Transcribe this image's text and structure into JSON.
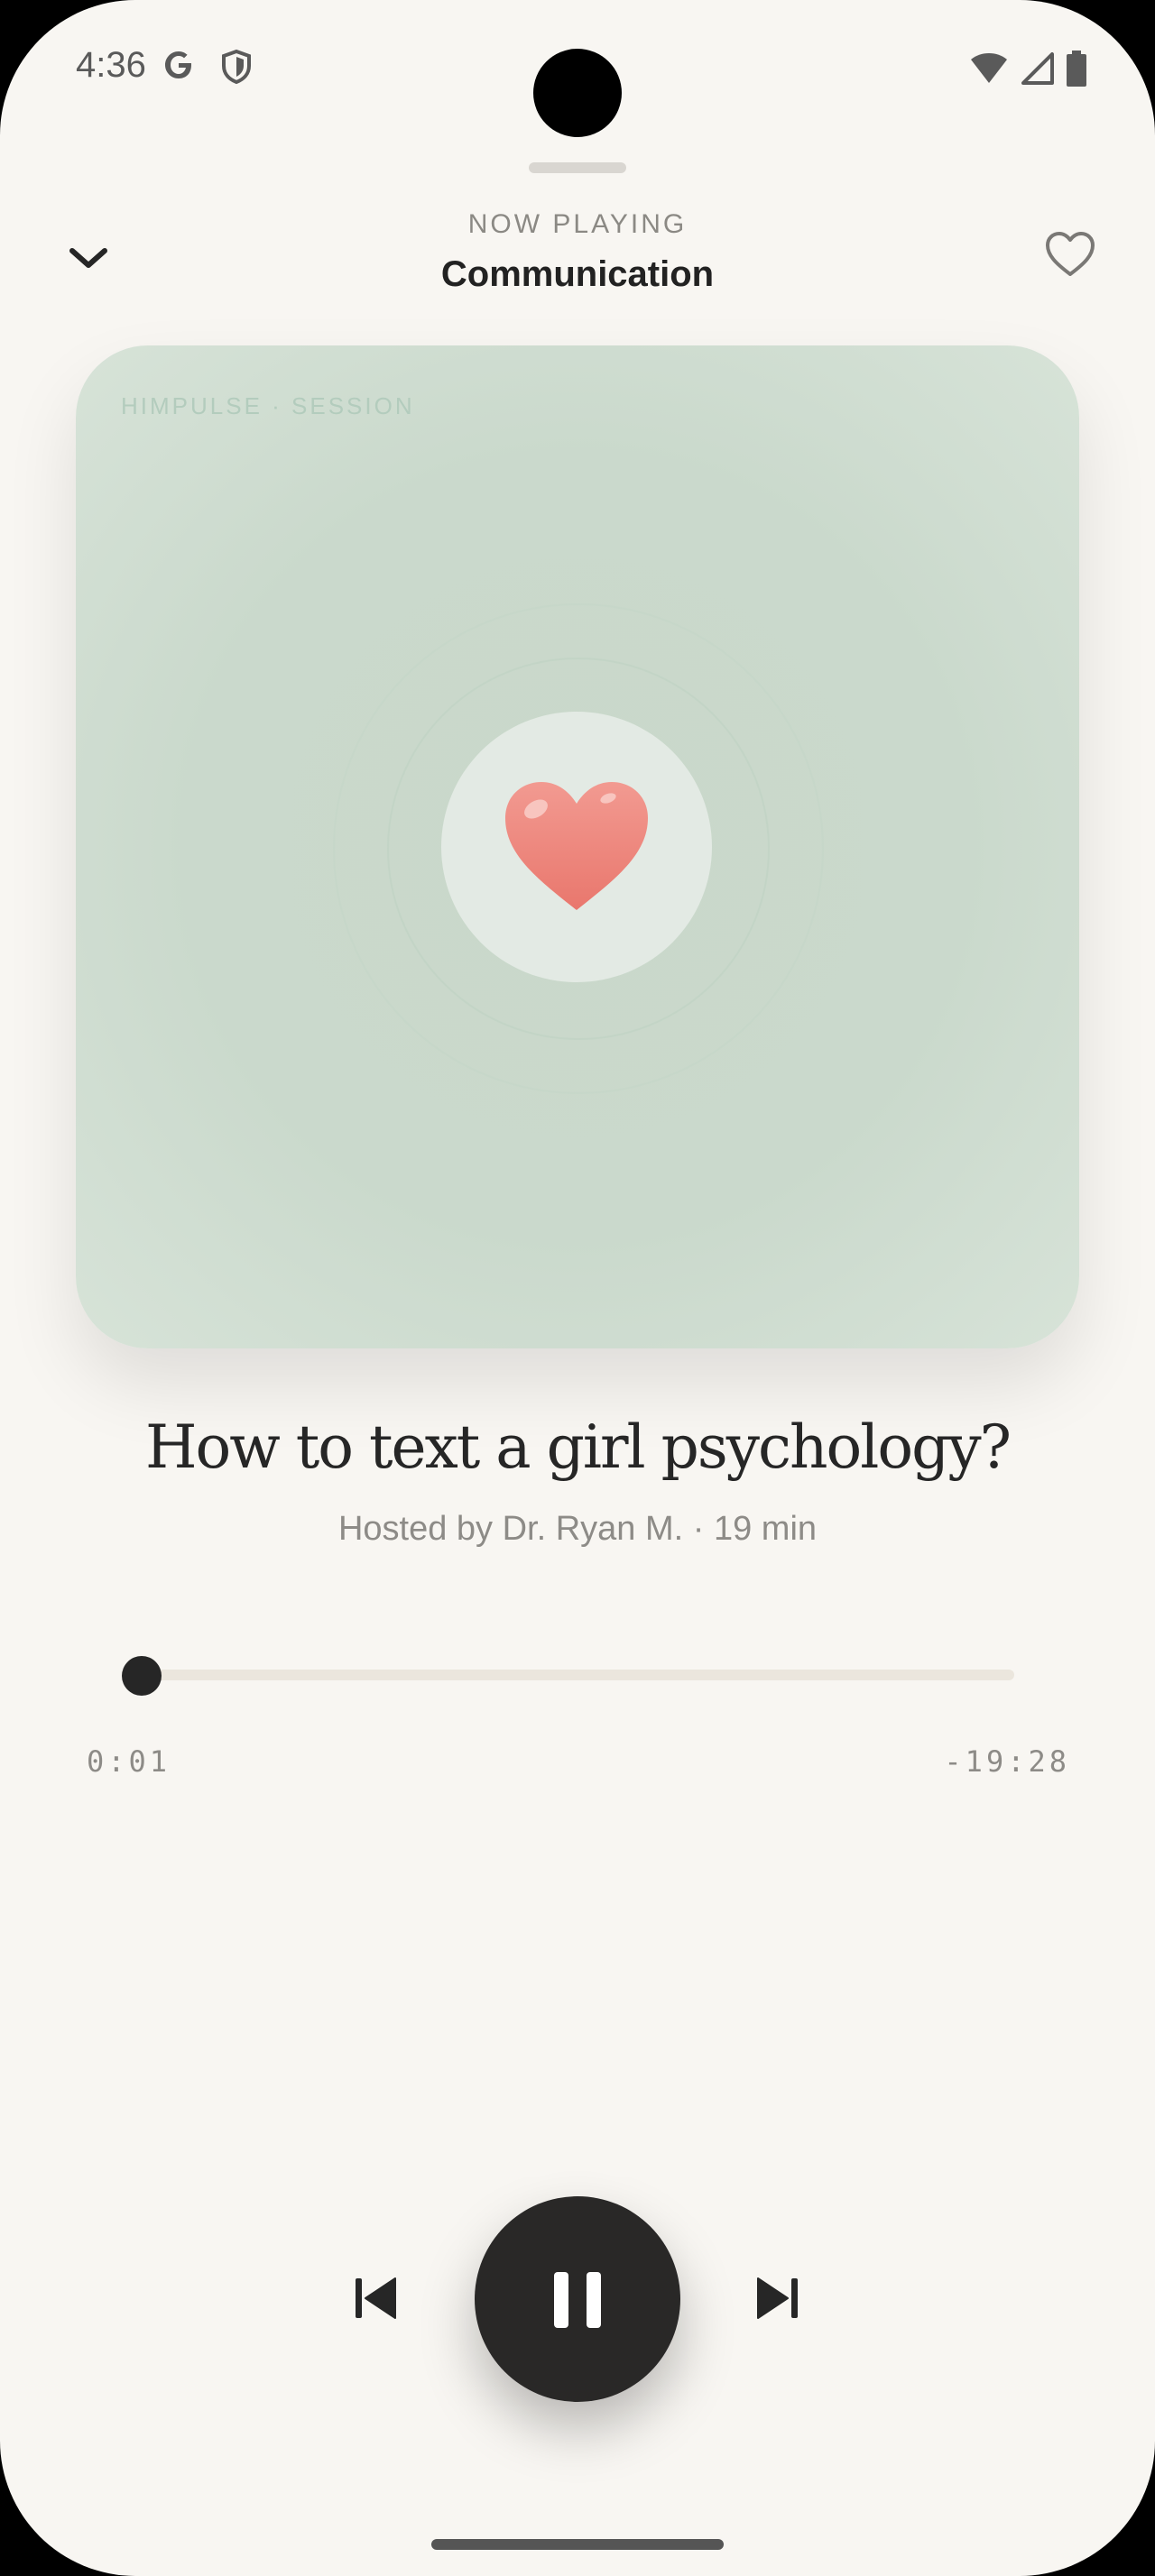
{
  "status_bar": {
    "time": "4:36"
  },
  "header": {
    "eyebrow": "NOW PLAYING",
    "title": "Communication"
  },
  "artwork": {
    "label": "HIMPULSE · SESSION",
    "emoji_icon": "heart-icon"
  },
  "episode": {
    "title": "How to text a girl psychology?",
    "meta": "Hosted by Dr. Ryan M. · 19 min"
  },
  "player": {
    "elapsed": "0:01",
    "remaining": "-19:28",
    "progress_fraction": 0.001,
    "state": "playing"
  },
  "colors": {
    "background": "#f8f6f2",
    "accent_dark": "#292827",
    "artwork_green": "#cad9cc",
    "heart": "#ef8b82"
  }
}
